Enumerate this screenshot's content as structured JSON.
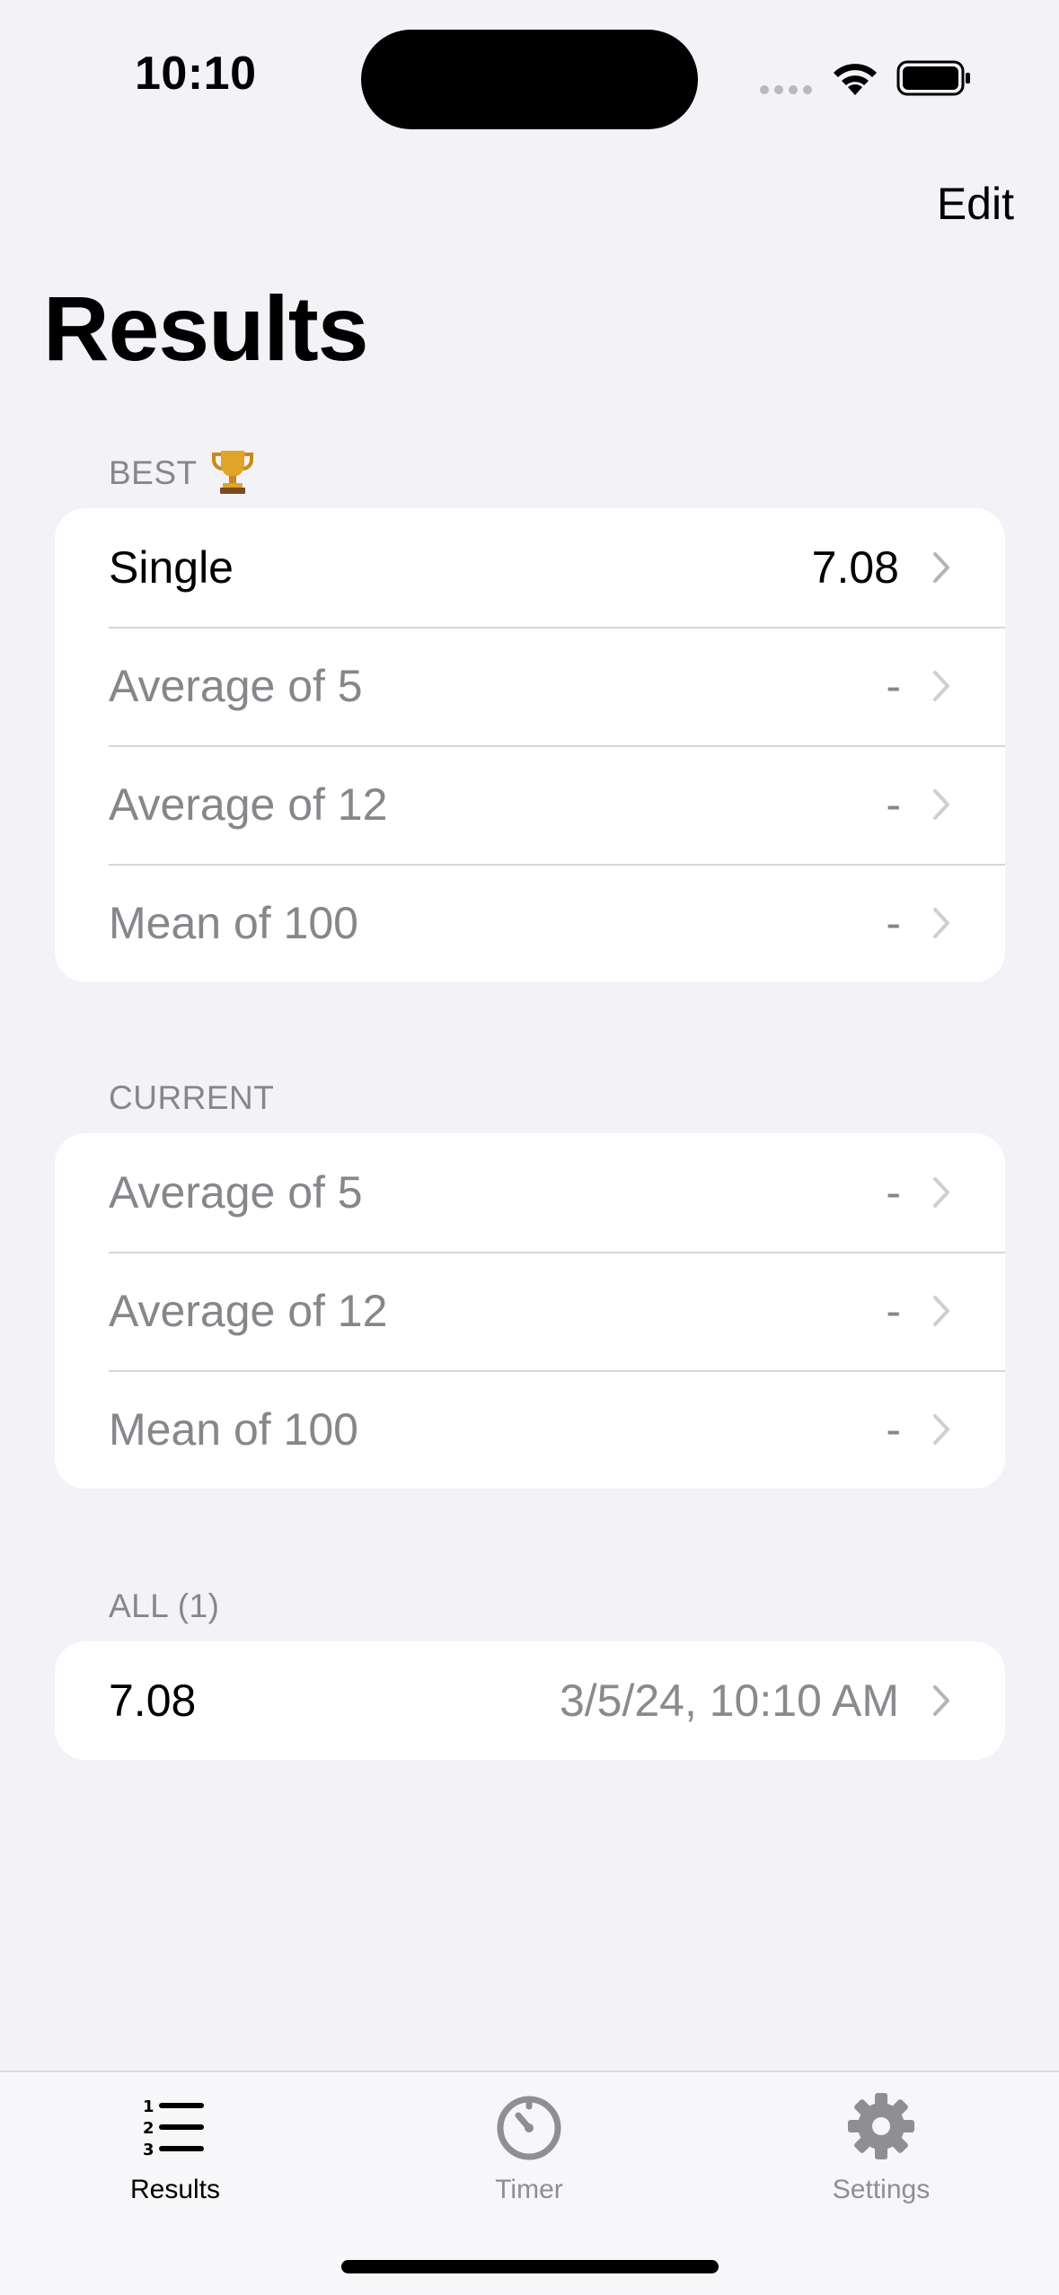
{
  "status_bar": {
    "time": "10:10"
  },
  "nav": {
    "edit_label": "Edit",
    "title": "Results"
  },
  "best": {
    "header": "BEST",
    "rows": [
      {
        "label": "Single",
        "value": "7.08"
      },
      {
        "label": "Average of 5",
        "value": "-"
      },
      {
        "label": "Average of 12",
        "value": "-"
      },
      {
        "label": "Mean of 100",
        "value": "-"
      }
    ]
  },
  "current": {
    "header": "CURRENT",
    "rows": [
      {
        "label": "Average of 5",
        "value": "-"
      },
      {
        "label": "Average of 12",
        "value": "-"
      },
      {
        "label": "Mean of 100",
        "value": "-"
      }
    ]
  },
  "all": {
    "header": "ALL (1)",
    "rows": [
      {
        "label": "7.08",
        "value": "3/5/24, 10:10 AM"
      }
    ]
  },
  "tab_bar": {
    "items": [
      {
        "label": "Results",
        "icon": "list-numbered-icon",
        "active": true
      },
      {
        "label": "Timer",
        "icon": "timer-icon",
        "active": false
      },
      {
        "label": "Settings",
        "icon": "gear-icon",
        "active": false
      }
    ]
  },
  "colors": {
    "background": "#f2f2f7",
    "card": "#ffffff",
    "secondary_text": "#86868b",
    "primary_text": "#000000"
  }
}
